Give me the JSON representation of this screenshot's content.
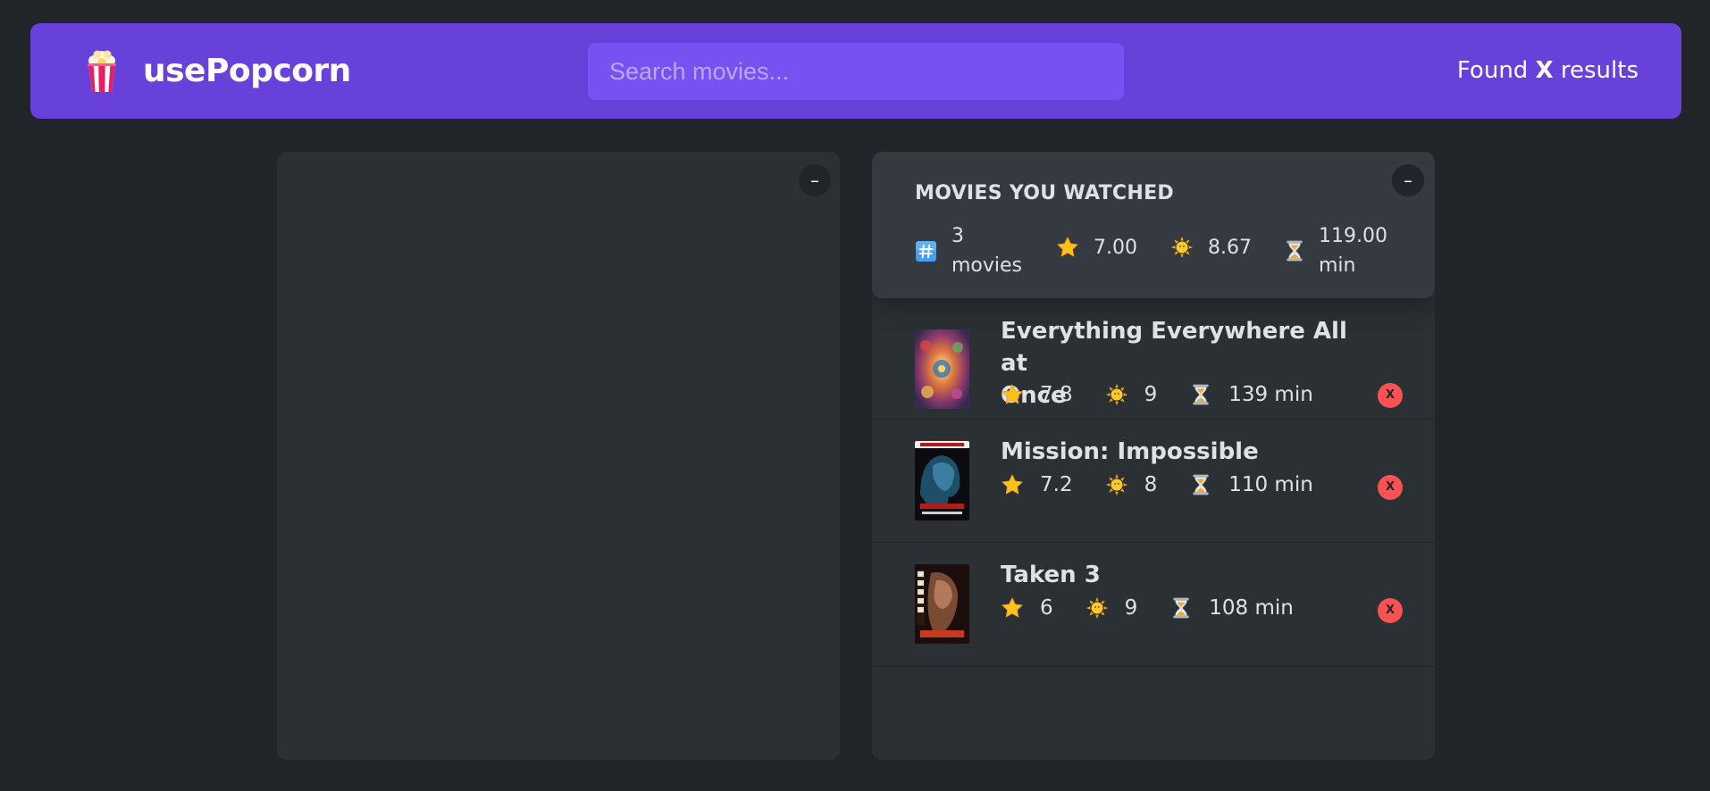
{
  "nav": {
    "logo_emoji": "popcorn-icon",
    "app_name": "usePopcorn",
    "search_placeholder": "Search movies...",
    "results_prefix": "Found ",
    "results_count": "X",
    "results_suffix": " results"
  },
  "left_box": {
    "toggle_label": "–"
  },
  "watched": {
    "toggle_label": "–",
    "title": "MOVIES YOU WATCHED",
    "stats": {
      "count_line1": "3",
      "count_line2": "movies",
      "avg_imdb": "7.00",
      "avg_user": "8.67",
      "runtime_line1": "119.00",
      "runtime_line2": "min"
    },
    "movies": [
      {
        "title_line1": "Everything Everywhere All at",
        "title_line2": "Once",
        "imdb": "7.8",
        "user": "9",
        "runtime": "139 min",
        "delete_label": "X"
      },
      {
        "title": "Mission: Impossible",
        "imdb": "7.2",
        "user": "8",
        "runtime": "110 min",
        "delete_label": "X"
      },
      {
        "title": "Taken 3",
        "imdb": "6",
        "user": "9",
        "runtime": "108 min",
        "delete_label": "X"
      }
    ]
  },
  "colors": {
    "background": "#212529",
    "nav": "#6741d9",
    "search": "#7950f2",
    "box": "#2b3035",
    "summary": "#343a40",
    "delete": "#fa5252"
  },
  "icons": {
    "count": "hash-keycap-icon",
    "imdb": "star-icon",
    "user": "sun-icon",
    "runtime": "hourglass-icon"
  }
}
